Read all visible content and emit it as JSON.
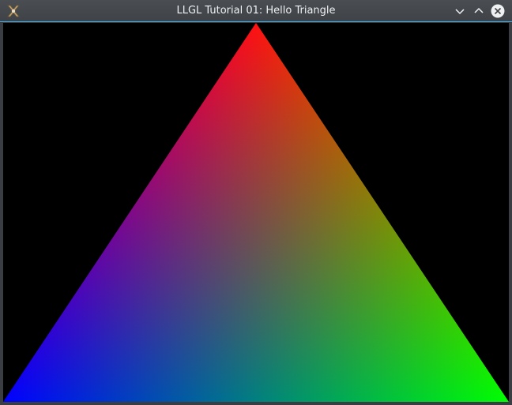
{
  "window": {
    "title": "LLGL Tutorial 01: Hello Triangle",
    "accent_color": "#3daee9"
  },
  "titlebar_controls": {
    "app_icon": "llgl-app-icon",
    "minimize_icon": "chevron-down-icon",
    "maximize_icon": "chevron-up-icon",
    "close_icon": "close-icon"
  },
  "scene": {
    "clear_color": "#000000",
    "vertex_colors": {
      "top": "#ff0000",
      "bottom_left": "#0000ff",
      "bottom_right": "#00ff00"
    }
  }
}
